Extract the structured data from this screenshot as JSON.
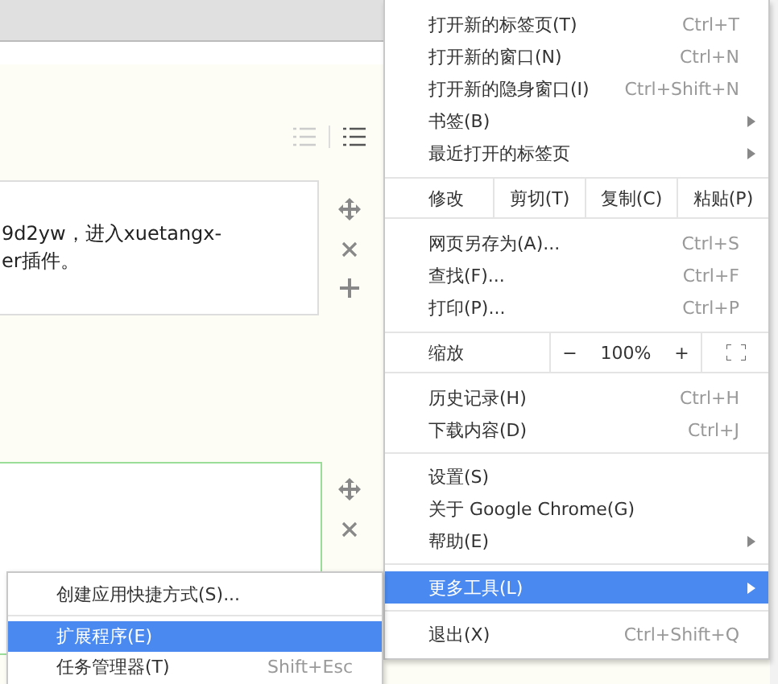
{
  "page": {
    "text_lines": [
      "9d2yw，进入xuetangx-",
      "er插件。"
    ]
  },
  "menu": {
    "items": [
      {
        "kind": "item",
        "label": "打开新的标签页(T)",
        "shortcut": "Ctrl+T",
        "has_submenu": false,
        "selected": false
      },
      {
        "kind": "item",
        "label": "打开新的窗口(N)",
        "shortcut": "Ctrl+N",
        "has_submenu": false,
        "selected": false
      },
      {
        "kind": "item",
        "label": "打开新的隐身窗口(I)",
        "shortcut": "Ctrl+Shift+N",
        "has_submenu": false,
        "selected": false
      },
      {
        "kind": "item",
        "label": "书签(B)",
        "has_submenu": true,
        "selected": false
      },
      {
        "kind": "item",
        "label": "最近打开的标签页",
        "has_submenu": true,
        "selected": false
      },
      {
        "kind": "edit",
        "label": "修改",
        "buttons": [
          "剪切(T)",
          "复制(C)",
          "粘贴(P)"
        ]
      },
      {
        "kind": "item",
        "label": "网页另存为(A)...",
        "shortcut": "Ctrl+S",
        "has_submenu": false,
        "selected": false
      },
      {
        "kind": "item",
        "label": "查找(F)...",
        "shortcut": "Ctrl+F",
        "has_submenu": false,
        "selected": false
      },
      {
        "kind": "item",
        "label": "打印(P)...",
        "shortcut": "Ctrl+P",
        "has_submenu": false,
        "selected": false
      },
      {
        "kind": "zoom",
        "label": "缩放",
        "minus": "−",
        "value": "100%",
        "plus": "+"
      },
      {
        "kind": "item",
        "label": "历史记录(H)",
        "shortcut": "Ctrl+H",
        "has_submenu": false,
        "selected": false
      },
      {
        "kind": "item",
        "label": "下载内容(D)",
        "shortcut": "Ctrl+J",
        "has_submenu": false,
        "selected": false
      },
      {
        "kind": "divider"
      },
      {
        "kind": "item",
        "label": "设置(S)",
        "has_submenu": false,
        "selected": false
      },
      {
        "kind": "item",
        "label": "关于 Google Chrome(G)",
        "has_submenu": false,
        "selected": false
      },
      {
        "kind": "item",
        "label": "帮助(E)",
        "has_submenu": true,
        "selected": false
      },
      {
        "kind": "divider"
      },
      {
        "kind": "item",
        "label": "更多工具(L)",
        "has_submenu": true,
        "selected": true
      },
      {
        "kind": "divider"
      },
      {
        "kind": "item",
        "label": "退出(X)",
        "shortcut": "Ctrl+Shift+Q",
        "has_submenu": false,
        "selected": false
      }
    ]
  },
  "submenu": {
    "items": [
      {
        "kind": "item",
        "label": "创建应用快捷方式(S)...",
        "selected": false
      },
      {
        "kind": "divider"
      },
      {
        "kind": "item",
        "label": "扩展程序(E)",
        "selected": true
      },
      {
        "kind": "item",
        "label": "任务管理器(T)",
        "shortcut": "Shift+Esc",
        "selected": false
      }
    ]
  }
}
